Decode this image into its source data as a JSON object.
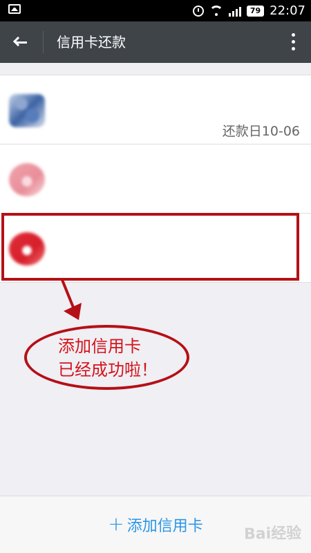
{
  "status_bar": {
    "battery": "79",
    "time": "22:07",
    "icons": [
      "image-icon",
      "alarm-icon",
      "wifi-icon",
      "signal-icon",
      "battery-icon"
    ]
  },
  "header": {
    "title": "信用卡还款",
    "back_icon": "back-arrow-icon",
    "more_icon": "more-vertical-icon"
  },
  "cards": [
    {
      "title": "",
      "subtitle": "",
      "amount": "",
      "due_date": "还款日10-06",
      "logo_color": "#3d63a4"
    },
    {
      "title": "",
      "subtitle": "",
      "amount": "",
      "due_date": "",
      "logo_color": "#e88e99"
    },
    {
      "title": "",
      "subtitle": "",
      "amount": "",
      "due_date": "",
      "logo_color": "#d71f2b"
    }
  ],
  "annotation": {
    "line1": "添加信用卡",
    "line2": "已经成功啦！",
    "accent": "#b41016"
  },
  "footer": {
    "add_label": "添加信用卡",
    "plus": "+"
  },
  "watermark": {
    "text": "Bai经验"
  }
}
